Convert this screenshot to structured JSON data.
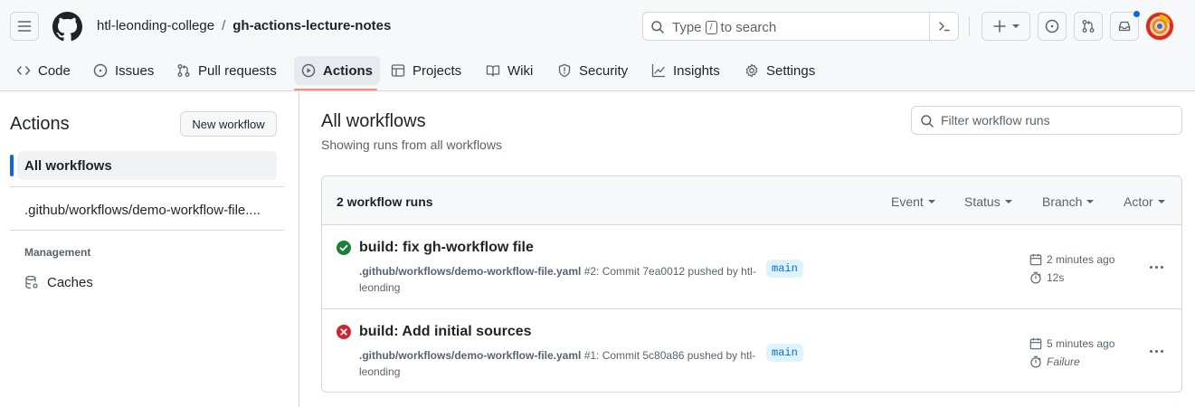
{
  "header": {
    "owner": "htl-leonding-college",
    "separator": "/",
    "repo": "gh-actions-lecture-notes",
    "search": {
      "prefix": "Type",
      "key": "/",
      "suffix": "to search"
    },
    "icons": [
      "hamburger-icon",
      "github-logo-icon",
      "search-icon",
      "command-palette-icon",
      "plus-icon",
      "issue-opened-icon",
      "git-pull-request-icon",
      "inbox-icon"
    ]
  },
  "nav": {
    "tabs": [
      {
        "label": "Code",
        "icon": "code-icon"
      },
      {
        "label": "Issues",
        "icon": "issue-opened-icon"
      },
      {
        "label": "Pull requests",
        "icon": "git-pull-request-icon"
      },
      {
        "label": "Actions",
        "icon": "play-icon",
        "active": true
      },
      {
        "label": "Projects",
        "icon": "table-icon"
      },
      {
        "label": "Wiki",
        "icon": "book-icon"
      },
      {
        "label": "Security",
        "icon": "shield-icon"
      },
      {
        "label": "Insights",
        "icon": "graph-icon"
      },
      {
        "label": "Settings",
        "icon": "gear-icon"
      }
    ]
  },
  "sidebar": {
    "title": "Actions",
    "new_workflow_label": "New workflow",
    "items": [
      {
        "label": "All workflows",
        "active": true
      },
      {
        "label": ".github/workflows/demo-workflow-file...."
      }
    ],
    "management_heading": "Management",
    "caches_label": "Caches"
  },
  "main": {
    "title": "All workflows",
    "subtitle": "Showing runs from all workflows",
    "filter_placeholder": "Filter workflow runs",
    "runs_count": "2 workflow runs",
    "filters": [
      "Event",
      "Status",
      "Branch",
      "Actor"
    ],
    "runs": [
      {
        "status": "success",
        "title": "build: fix gh-workflow file",
        "workflow_file": ".github/workflows/demo-workflow-file.yaml",
        "run_desc": "#2: Commit 7ea0012 pushed by htl-leonding",
        "branch": "main",
        "time_ago": "2 minutes ago",
        "duration": "12s"
      },
      {
        "status": "failure",
        "title": "build: Add initial sources",
        "workflow_file": ".github/workflows/demo-workflow-file.yaml",
        "run_desc": "#1: Commit 5c80a86 pushed by htl-leonding",
        "branch": "main",
        "time_ago": "5 minutes ago",
        "duration": "Failure"
      }
    ]
  },
  "colors": {
    "accent": "#0969da",
    "tab_underline": "#fd8c73",
    "success": "#1a7f37",
    "failure": "#d1242f",
    "branch_bg": "#ddf4ff"
  }
}
